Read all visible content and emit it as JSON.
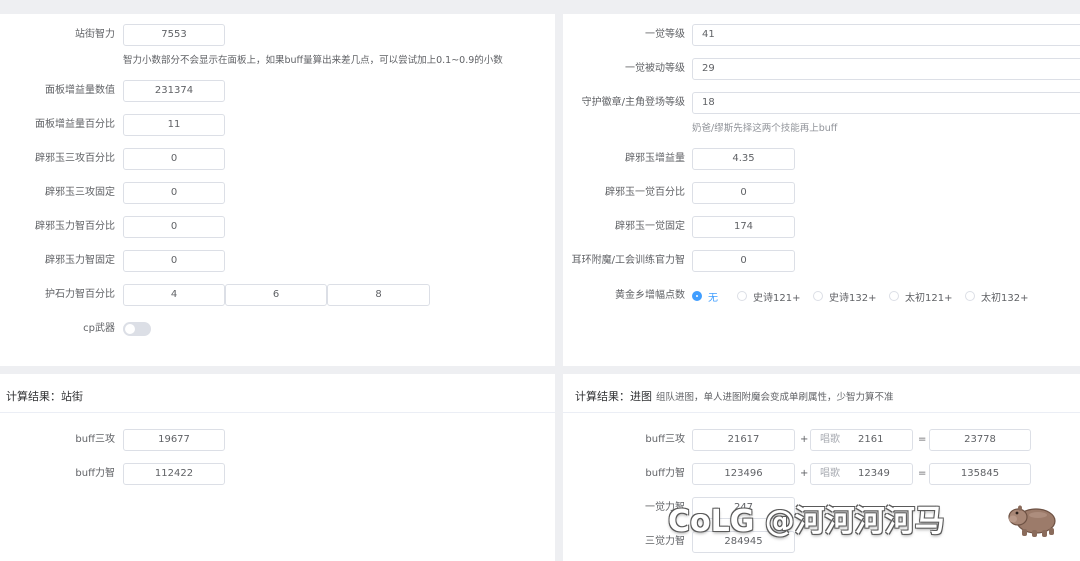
{
  "left_form": {
    "intel_label": "站街智力",
    "intel_value": "7553",
    "intel_hint": "智力小数部分不会显示在面板上，如果buff量算出来差几点，可以尝试加上0.1~0.9的小数",
    "panel_buff_label": "面板增益量数值",
    "panel_buff_value": "231374",
    "panel_pct_label": "面板增益量百分比",
    "panel_pct_value": "11",
    "jade_atk_pct_label": "辟邪玉三攻百分比",
    "jade_atk_pct_value": "0",
    "jade_atk_fixed_label": "辟邪玉三攻固定",
    "jade_atk_fixed_value": "0",
    "jade_str_pct_label": "辟邪玉力智百分比",
    "jade_str_pct_value": "0",
    "jade_str_fixed_label": "辟邪玉力智固定",
    "jade_str_fixed_value": "0",
    "stone_label": "护石力智百分比",
    "stone_values": [
      "4",
      "6",
      "8"
    ],
    "cp_label": "cp武器"
  },
  "right_form": {
    "awaken_level_label": "一觉等级",
    "awaken_level_value": "41",
    "awaken_passive_label": "一觉被动等级",
    "awaken_passive_value": "29",
    "guard_label": "守护徽章/主角登场等级",
    "guard_value": "18",
    "guard_hint": "奶爸/缪斯先择这两个技能再上buff",
    "jade_gain_label": "辟邪玉增益量",
    "jade_gain_value": "4.35",
    "jade_awaken_pct_label": "辟邪玉一觉百分比",
    "jade_awaken_pct_value": "0",
    "jade_awaken_fixed_label": "辟邪玉一觉固定",
    "jade_awaken_fixed_value": "174",
    "earring_label": "耳环附魔/工会训练官力智",
    "earring_value": "0",
    "gold_label": "黄金乡增幅点数",
    "gold_options": [
      "无",
      "史诗121+",
      "史诗132+",
      "太初121+",
      "太初132+"
    ],
    "gold_selected": 0
  },
  "result_street": {
    "title": "计算结果：站街",
    "atk_label": "buff三攻",
    "atk_value": "19677",
    "str_label": "buff力智",
    "str_value": "112422"
  },
  "result_dungeon": {
    "title": "计算结果：进图",
    "subtitle": "组队进图，单人进图附魔会变成单刷属性，少智力算不准",
    "atk_label": "buff三攻",
    "atk_base": "21617",
    "plus": "+",
    "song_prefix": "唱歌",
    "atk_song": "2161",
    "equals": "=",
    "atk_total": "23778",
    "str_label": "buff力智",
    "str_base": "123496",
    "str_song": "12349",
    "str_total": "135845",
    "awaken1_label": "一觉力智",
    "awaken1_value": "247",
    "awaken3_label": "三觉力智",
    "awaken3_value": "284945"
  },
  "watermark": {
    "text": "CoLG @河河河河马",
    "icon": "hippo-icon"
  },
  "colors": {
    "accent": "#409eff",
    "border": "#dcdfe6",
    "text": "#606266",
    "page_bg": "#eeeff2"
  }
}
